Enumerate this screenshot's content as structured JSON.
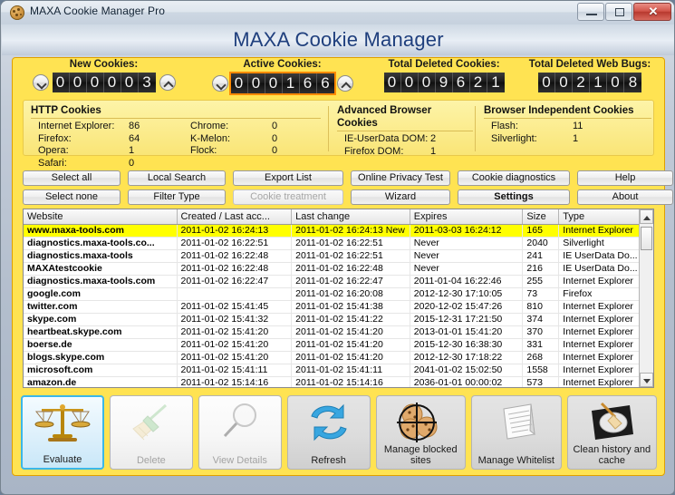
{
  "window": {
    "title": "MAXA Cookie Manager Pro",
    "icon": "cookie-icon",
    "controls": {
      "minimize": "minimize-icon",
      "maximize": "maximize-icon",
      "close": "✕"
    }
  },
  "banner": {
    "title": "MAXA Cookie Manager"
  },
  "counters": [
    {
      "label": "New Cookies:",
      "digits": [
        "0",
        "0",
        "0",
        "0",
        "0",
        "3"
      ],
      "highlight": false,
      "down": "▼",
      "up": "▲"
    },
    {
      "label": "Active Cookies:",
      "digits": [
        "0",
        "0",
        "0",
        "1",
        "6",
        "6"
      ],
      "highlight": true,
      "down": "▼",
      "up": "▲"
    },
    {
      "label": "Total Deleted Cookies:",
      "digits": [
        "0",
        "0",
        "0",
        "9",
        "6",
        "2",
        "1"
      ],
      "highlight": false
    },
    {
      "label": "Total Deleted Web Bugs:",
      "digits": [
        "0",
        "0",
        "2",
        "1",
        "0",
        "8"
      ],
      "highlight": false
    }
  ],
  "info": {
    "http": {
      "title": "HTTP Cookies",
      "left": [
        {
          "k": "Internet Explorer:",
          "v": "86"
        },
        {
          "k": "Firefox:",
          "v": "64"
        },
        {
          "k": "Opera:",
          "v": "1"
        },
        {
          "k": "Safari:",
          "v": "0"
        }
      ],
      "right": [
        {
          "k": "Chrome:",
          "v": "0"
        },
        {
          "k": "K-Melon:",
          "v": "0"
        },
        {
          "k": "Flock:",
          "v": "0"
        }
      ]
    },
    "advanced": {
      "title": "Advanced Browser Cookies",
      "rows": [
        {
          "k": "IE-UserData DOM:",
          "v": "2"
        },
        {
          "k": "Firefox DOM:",
          "v": "1"
        }
      ]
    },
    "independent": {
      "title": "Browser Independent Cookies",
      "rows": [
        {
          "k": "Flash:",
          "v": "11"
        },
        {
          "k": "Silverlight:",
          "v": "1"
        }
      ]
    }
  },
  "toolbuttons": [
    {
      "label": "Select all",
      "disabled": false,
      "bold": false
    },
    {
      "label": "Local Search",
      "disabled": false,
      "bold": false
    },
    {
      "label": "Export List",
      "disabled": false,
      "bold": false
    },
    {
      "label": "Online Privacy Test",
      "disabled": false,
      "bold": false
    },
    {
      "label": "Cookie diagnostics",
      "disabled": false,
      "bold": false
    },
    {
      "label": "Help",
      "disabled": false,
      "bold": false
    },
    {
      "label": "Select none",
      "disabled": false,
      "bold": false
    },
    {
      "label": "Filter Type",
      "disabled": false,
      "bold": false
    },
    {
      "label": "Cookie treatment",
      "disabled": true,
      "bold": false
    },
    {
      "label": "Wizard",
      "disabled": false,
      "bold": false
    },
    {
      "label": "Settings",
      "disabled": false,
      "bold": true
    },
    {
      "label": "About",
      "disabled": false,
      "bold": false
    }
  ],
  "table": {
    "columns": [
      "Website",
      "Created / Last acc...",
      "Last change",
      "Expires",
      "Size",
      "Type"
    ],
    "rows": [
      {
        "selected": true,
        "website": "www.maxa-tools.com",
        "created": "2011-01-02 16:24:13",
        "changed": "2011-01-02 16:24:13 New",
        "expires": "2011-03-03 16:24:12",
        "size": "165",
        "type": "Internet Explorer"
      },
      {
        "selected": false,
        "website": "diagnostics.maxa-tools.co...",
        "created": "2011-01-02 16:22:51",
        "changed": "2011-01-02 16:22:51",
        "expires": "Never",
        "size": "2040",
        "type": "Silverlight"
      },
      {
        "selected": false,
        "website": "diagnostics.maxa-tools",
        "created": "2011-01-02 16:22:48",
        "changed": "2011-01-02 16:22:51",
        "expires": "Never",
        "size": "241",
        "type": "IE UserData Do..."
      },
      {
        "selected": false,
        "website": "MAXAtestcookie",
        "created": "2011-01-02 16:22:48",
        "changed": "2011-01-02 16:22:48",
        "expires": "Never",
        "size": "216",
        "type": "IE UserData Do..."
      },
      {
        "selected": false,
        "website": "diagnostics.maxa-tools.com",
        "created": "2011-01-02 16:22:47",
        "changed": "2011-01-02 16:22:47",
        "expires": "2011-01-04 16:22:46",
        "size": "255",
        "type": "Internet Explorer"
      },
      {
        "selected": false,
        "website": "google.com",
        "created": "",
        "changed": "2011-01-02 16:20:08",
        "expires": "2012-12-30 17:10:05",
        "size": "73",
        "type": "Firefox"
      },
      {
        "selected": false,
        "website": "twitter.com",
        "created": "2011-01-02 15:41:45",
        "changed": "2011-01-02 15:41:38",
        "expires": "2020-12-02 15:47:26",
        "size": "810",
        "type": "Internet Explorer"
      },
      {
        "selected": false,
        "website": "skype.com",
        "created": "2011-01-02 15:41:32",
        "changed": "2011-01-02 15:41:22",
        "expires": "2015-12-31 17:21:50",
        "size": "374",
        "type": "Internet Explorer"
      },
      {
        "selected": false,
        "website": "heartbeat.skype.com",
        "created": "2011-01-02 15:41:20",
        "changed": "2011-01-02 15:41:20",
        "expires": "2013-01-01 15:41:20",
        "size": "370",
        "type": "Internet Explorer"
      },
      {
        "selected": false,
        "website": "boerse.de",
        "created": "2011-01-02 15:41:20",
        "changed": "2011-01-02 15:41:20",
        "expires": "2015-12-30 16:38:30",
        "size": "331",
        "type": "Internet Explorer"
      },
      {
        "selected": false,
        "website": "blogs.skype.com",
        "created": "2011-01-02 15:41:20",
        "changed": "2011-01-02 15:41:20",
        "expires": "2012-12-30 17:18:22",
        "size": "268",
        "type": "Internet Explorer"
      },
      {
        "selected": false,
        "website": "microsoft.com",
        "created": "2011-01-02 15:41:11",
        "changed": "2011-01-02 15:41:11",
        "expires": "2041-01-02 15:02:50",
        "size": "1558",
        "type": "Internet Explorer"
      },
      {
        "selected": false,
        "website": "amazon.de",
        "created": "2011-01-02 15:14:16",
        "changed": "2011-01-02 15:14:16",
        "expires": "2036-01-01 00:00:02",
        "size": "573",
        "type": "Internet Explorer"
      }
    ]
  },
  "bigbuttons": [
    {
      "label": "Evaluate",
      "icon": "scales-icon",
      "state": "active"
    },
    {
      "label": "Delete",
      "icon": "broom-icon",
      "state": "dim"
    },
    {
      "label": "View Details",
      "icon": "magnifier-icon",
      "state": "dim"
    },
    {
      "label": "Refresh",
      "icon": "refresh-icon",
      "state": "grey"
    },
    {
      "label": "Manage blocked sites",
      "icon": "blocked-cookies-icon",
      "state": "grey"
    },
    {
      "label": "Manage Whitelist",
      "icon": "notepad-icon",
      "state": "grey"
    },
    {
      "label": "Clean history and cache",
      "icon": "disc-broom-icon",
      "state": "grey"
    }
  ],
  "colors": {
    "panel_yellow": "#ffe352",
    "info_yellow": "#fbeb8b",
    "selected_row": "#ffff00",
    "highlight_orange": "#ff8a00",
    "banner_blue": "#1f3f7d",
    "active_border": "#3bb7e8"
  }
}
